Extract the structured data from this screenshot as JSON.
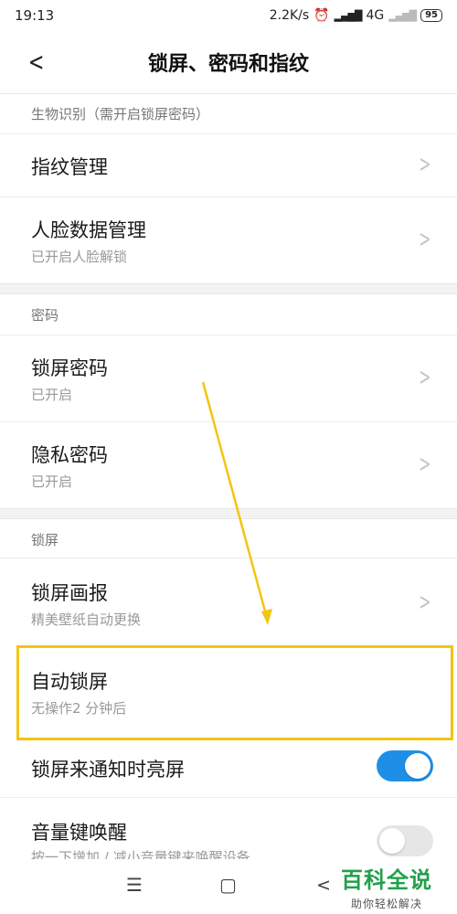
{
  "status_bar": {
    "time": "19:13",
    "speed": "2.2K/s",
    "network": "4G",
    "battery": "95"
  },
  "header": {
    "back_icon": "chevron-left-icon",
    "title": "锁屏、密码和指纹"
  },
  "sections": {
    "biometrics": {
      "label": "生物识别（需开启锁屏密码）",
      "fingerprint": {
        "title": "指纹管理"
      },
      "face": {
        "title": "人脸数据管理",
        "subtitle": "已开启人脸解锁"
      }
    },
    "password": {
      "label": "密码",
      "lock_password": {
        "title": "锁屏密码",
        "subtitle": "已开启"
      },
      "privacy_password": {
        "title": "隐私密码",
        "subtitle": "已开启"
      }
    },
    "lockscreen": {
      "label": "锁屏",
      "wallpaper": {
        "title": "锁屏画报",
        "subtitle": "精美壁纸自动更换"
      },
      "auto_lock": {
        "title": "自动锁屏",
        "subtitle": "无操作2 分钟后"
      },
      "wake_on_notify": {
        "title": "锁屏来通知时亮屏",
        "toggle_on": true
      },
      "volume_wake": {
        "title": "音量键唤醒",
        "subtitle": "按一下增加 / 减小音量键来唤醒设备",
        "toggle_on": false
      }
    }
  },
  "colors": {
    "accent": "#1e8fe6",
    "highlight": "#f2c511",
    "brand": "#22a04b"
  },
  "watermark": {
    "title": "百科全说",
    "subtitle": "助你轻松解决"
  },
  "navbar": {
    "menu_icon": "menu-icon",
    "home_icon": "home-square-icon",
    "back_icon": "back-triangle-icon"
  }
}
